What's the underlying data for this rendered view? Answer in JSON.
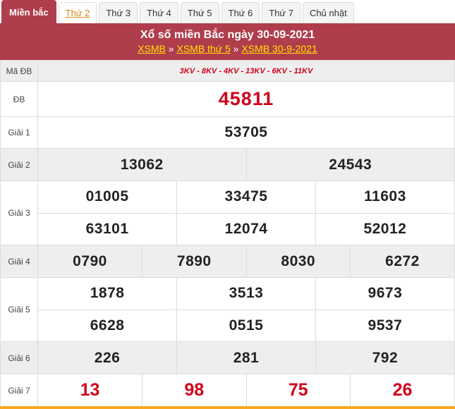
{
  "tabs": [
    {
      "label": "Miền bắc",
      "state": "active"
    },
    {
      "label": "Thứ 2",
      "state": "current"
    },
    {
      "label": "Thứ 3",
      "state": ""
    },
    {
      "label": "Thứ 4",
      "state": ""
    },
    {
      "label": "Thứ 5",
      "state": ""
    },
    {
      "label": "Thứ 6",
      "state": ""
    },
    {
      "label": "Thứ 7",
      "state": ""
    },
    {
      "label": "Chủ nhật",
      "state": ""
    }
  ],
  "header": {
    "title": "Xổ số miền Bắc ngày 30-09-2021",
    "crumbs": [
      {
        "label": "XSMB"
      },
      {
        "label": "XSMB thứ 5"
      },
      {
        "label": "XSMB 30-9-2021"
      }
    ],
    "sep": "»"
  },
  "results": {
    "ma_db": {
      "label": "Mã ĐB",
      "value": "3KV - 8KV - 4KV - 13KV - 6KV - 11KV"
    },
    "db": {
      "label": "ĐB",
      "value": "45811"
    },
    "g1": {
      "label": "Giải 1",
      "values": [
        "53705"
      ]
    },
    "g2": {
      "label": "Giải 2",
      "values": [
        "13062",
        "24543"
      ]
    },
    "g3": {
      "label": "Giải 3",
      "values": [
        "01005",
        "33475",
        "11603",
        "63101",
        "12074",
        "52012"
      ]
    },
    "g4": {
      "label": "Giải 4",
      "values": [
        "0790",
        "7890",
        "8030",
        "6272"
      ]
    },
    "g5": {
      "label": "Giải 5",
      "values": [
        "1878",
        "3513",
        "9673",
        "6628",
        "0515",
        "9537"
      ]
    },
    "g6": {
      "label": "Giải 6",
      "values": [
        "226",
        "281",
        "792"
      ]
    },
    "g7": {
      "label": "Giải 7",
      "values": [
        "13",
        "98",
        "75",
        "26"
      ]
    }
  },
  "colors": {
    "header_bg": "#b03d4c",
    "link_yellow": "#ffe400",
    "prize_red": "#d0021b",
    "current_tab": "#d8891a",
    "bottom_bar": "#f5a623"
  }
}
